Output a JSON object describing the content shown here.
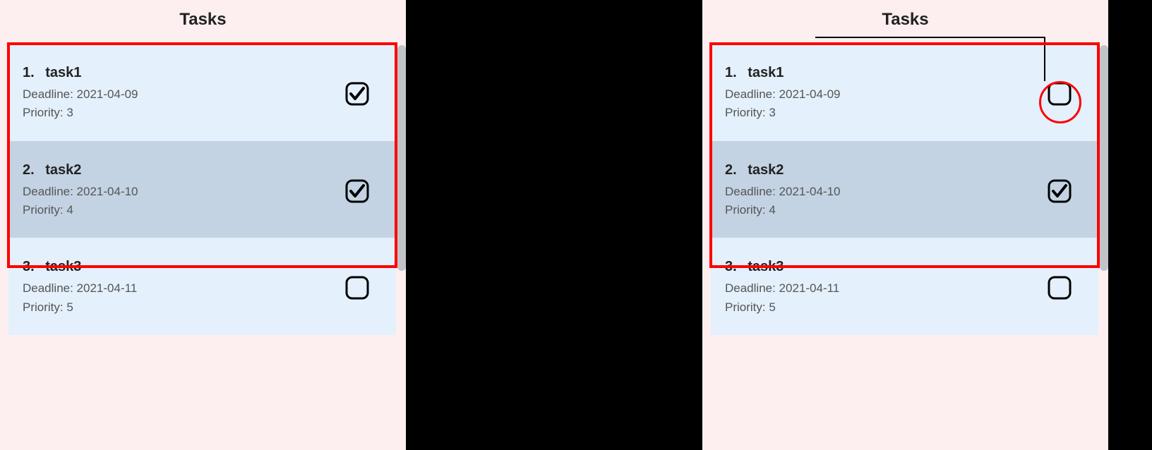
{
  "leftPanel": {
    "title": "Tasks",
    "tasks": [
      {
        "index": "1.",
        "title": "task1",
        "deadlineLabel": "Deadline: 2021-04-09",
        "priorityLabel": "Priority: 3",
        "checked": true
      },
      {
        "index": "2.",
        "title": "task2",
        "deadlineLabel": "Deadline: 2021-04-10",
        "priorityLabel": "Priority: 4",
        "checked": true
      },
      {
        "index": "3.",
        "title": "task3",
        "deadlineLabel": "Deadline: 2021-04-11",
        "priorityLabel": "Priority: 5",
        "checked": false
      }
    ]
  },
  "rightPanel": {
    "title": "Tasks",
    "tasks": [
      {
        "index": "1.",
        "title": "task1",
        "deadlineLabel": "Deadline: 2021-04-09",
        "priorityLabel": "Priority: 3",
        "checked": false
      },
      {
        "index": "2.",
        "title": "task2",
        "deadlineLabel": "Deadline: 2021-04-10",
        "priorityLabel": "Priority: 4",
        "checked": true
      },
      {
        "index": "3.",
        "title": "task3",
        "deadlineLabel": "Deadline: 2021-04-11",
        "priorityLabel": "Priority: 5",
        "checked": false
      }
    ]
  }
}
